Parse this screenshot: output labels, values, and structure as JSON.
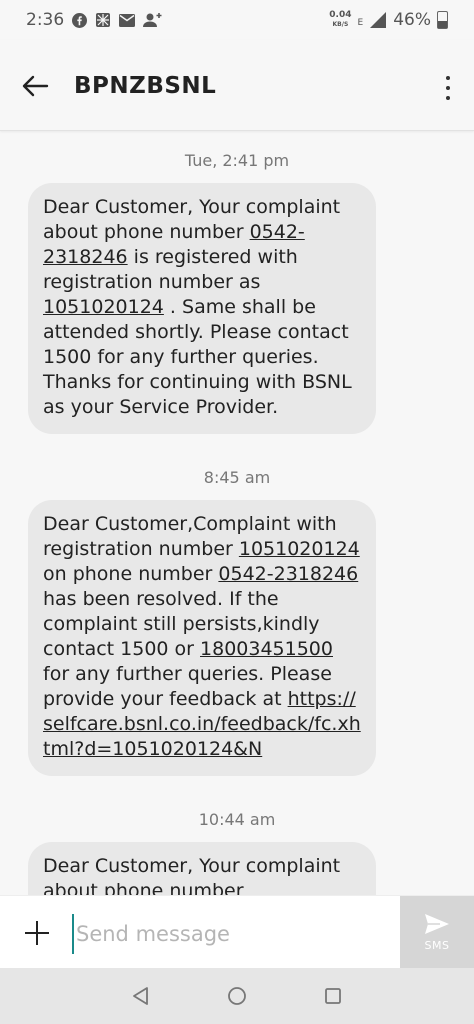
{
  "status_bar": {
    "time": "2:36",
    "net_speed": "0.04",
    "net_unit": "KB/S",
    "network_type": "E",
    "battery": "46%",
    "icons": [
      "facebook-icon",
      "app-icon",
      "mail-icon",
      "add-person-icon",
      "signal-icon",
      "battery-icon"
    ]
  },
  "app_bar": {
    "title": "BPNZBSNL"
  },
  "messages": [
    {
      "timestamp": "Tue, 2:41 pm",
      "parts": [
        {
          "text": "Dear Customer, Your complaint about phone number "
        },
        {
          "text": "0542-2318246",
          "link": true
        },
        {
          "text": " is registered with registration number as "
        },
        {
          "text": "1051020124",
          "link": true
        },
        {
          "text": " . Same shall be attended shortly. Please contact 1500 for any further queries. Thanks for continuing with BSNL as your Service Provider."
        }
      ]
    },
    {
      "timestamp": "8:45 am",
      "parts": [
        {
          "text": "Dear Customer,Complaint with registration number "
        },
        {
          "text": "1051020124",
          "link": true
        },
        {
          "text": " on phone number "
        },
        {
          "text": "0542-2318246",
          "link": true
        },
        {
          "text": " has been resolved. If the complaint still persists,kindly contact 1500 or "
        },
        {
          "text": "18003451500",
          "link": true
        },
        {
          "text": " for any further queries. Please provide your feedback at "
        },
        {
          "text": "https://selfcare.bsnl.co.in/feedback/fc.xhtml?d=1051020124&N",
          "link": true
        }
      ]
    },
    {
      "timestamp": "10:44 am",
      "parts": [
        {
          "text": "Dear Customer, Your complaint about phone number"
        }
      ]
    }
  ],
  "compose": {
    "placeholder": "Send message",
    "send_label": "SMS"
  },
  "colors": {
    "background": "#f7f7f7",
    "bubble": "#e8e8e8",
    "send_button": "#d6d6d6",
    "cursor": "#1a8a8a"
  }
}
